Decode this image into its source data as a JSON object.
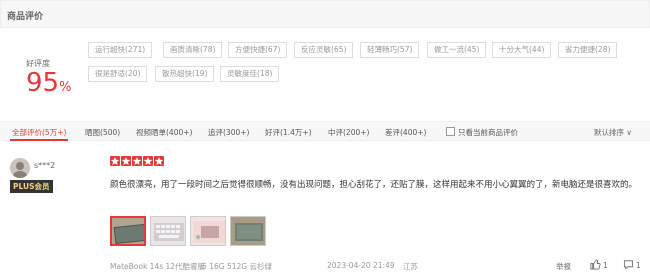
{
  "header": {
    "title": "商品评价"
  },
  "rating": {
    "label": "好评度",
    "value": "95",
    "unit": "%"
  },
  "tags": [
    "运行超快(271)",
    "画质清晰(78)",
    "方便快捷(67)",
    "反应灵敏(65)",
    "轻薄畅巧(57)",
    "做工一流(45)",
    "十分大气(44)",
    "省力便捷(28)",
    "很是舒适(20)",
    "散热超快(19)",
    "灵敏度佳(18)"
  ],
  "filters": {
    "tabs": [
      "全部评价(5万+)",
      "晒图(500)",
      "视频晒单(400+)",
      "追评(300+)",
      "好评(1.4万+)",
      "中评(200+)",
      "差评(400+)"
    ],
    "only_current_label": "只看当前商品评价",
    "sort_label": "默认排序"
  },
  "review": {
    "username": "s***2",
    "badge": "PLUS会员",
    "star_count": 5,
    "text": "颜色很漂亮，用了一段时间之后觉得很顺畅，没有出现问题，担心刮花了，还贴了膜，这样用起来不用小心翼翼的了，新电脑还是很喜欢的。",
    "images_count": 4,
    "product": "MateBook 14s 12代酷睿版",
    "spec": "i5 16G 512G 云杉绿",
    "date": "2023-04-20 21:49",
    "location": "江苏",
    "report_label": "举报",
    "like_count": "1",
    "comment_count": "1"
  },
  "colors": {
    "accent": "#e4393c",
    "badge_bg": "#333333",
    "badge_text": "#f2d27e"
  }
}
